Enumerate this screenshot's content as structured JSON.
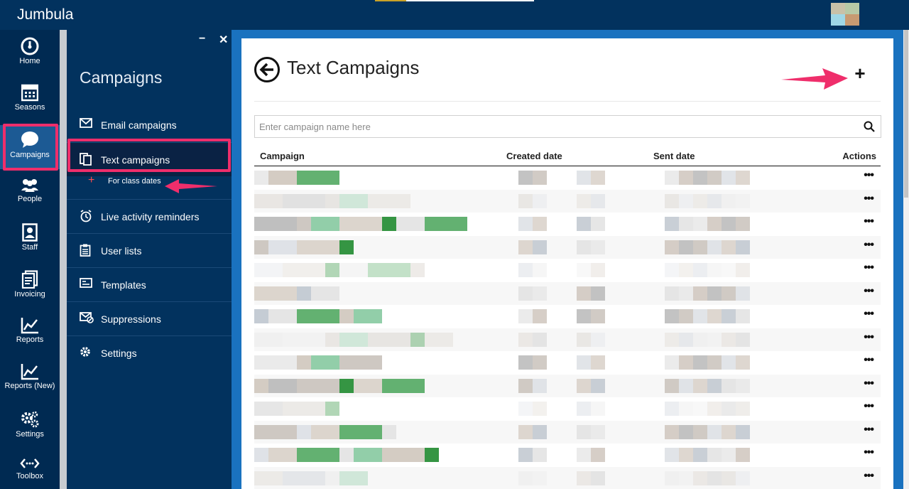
{
  "app": {
    "brand": "Jumbula"
  },
  "rail": {
    "items": [
      {
        "id": "home",
        "label": "Home",
        "icon": "speedometer-icon"
      },
      {
        "id": "seasons",
        "label": "Seasons",
        "icon": "calendar-icon"
      },
      {
        "id": "campaigns",
        "label": "Campaigns",
        "icon": "chat-bubble-icon",
        "active": true
      },
      {
        "id": "people",
        "label": "People",
        "icon": "people-icon"
      },
      {
        "id": "staff",
        "label": "Staff",
        "icon": "id-badge-icon"
      },
      {
        "id": "invoicing",
        "label": "Invoicing",
        "icon": "invoice-icon"
      },
      {
        "id": "reports",
        "label": "Reports",
        "icon": "line-chart-icon"
      },
      {
        "id": "reports-new",
        "label": "Reports (New)",
        "icon": "line-chart-icon"
      },
      {
        "id": "settings",
        "label": "Settings",
        "icon": "gears-icon"
      },
      {
        "id": "toolbox",
        "label": "Toolbox",
        "icon": "code-arrows-icon"
      }
    ]
  },
  "subpanel": {
    "title": "Campaigns",
    "minimize": "−",
    "close": "✕",
    "items": [
      {
        "id": "email",
        "label": "Email campaigns",
        "icon": "envelope-icon"
      },
      {
        "id": "text",
        "label": "Text campaigns",
        "icon": "copy-icon",
        "active": true
      },
      {
        "id": "live",
        "label": "Live activity reminders",
        "icon": "alarm-clock-icon"
      },
      {
        "id": "userlists",
        "label": "User lists",
        "icon": "clipboard-icon"
      },
      {
        "id": "templates",
        "label": "Templates",
        "icon": "card-icon"
      },
      {
        "id": "suppressions",
        "label": "Suppressions",
        "icon": "envelope-block-icon"
      },
      {
        "id": "settings",
        "label": "Settings",
        "icon": "gear-icon"
      }
    ],
    "subitem": {
      "plus": "+",
      "label": "For class dates"
    }
  },
  "main": {
    "title": "Text Campaigns",
    "add_label": "+",
    "search": {
      "placeholder": "Enter campaign name here",
      "value": ""
    },
    "columns": [
      "Campaign",
      "Created date",
      "Sent date",
      "Actions"
    ],
    "row_action": "•••",
    "row_count": 14
  },
  "colors": {
    "topbar": "#02325e",
    "rail": "#002a52",
    "frame": "#1a72bf",
    "highlight": "#ef2e6b",
    "active_rail": "#1c5a94"
  }
}
